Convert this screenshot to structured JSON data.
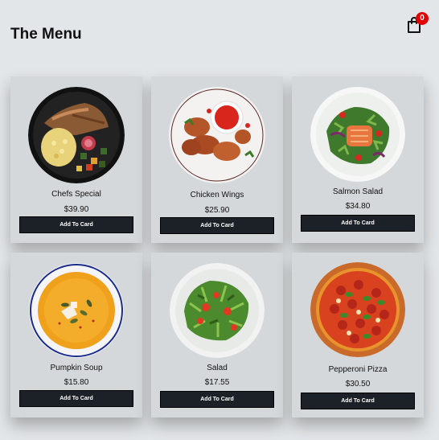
{
  "header": {
    "title": "The Menu",
    "cart_count": "0",
    "cart_icon": "shopping-bag-icon"
  },
  "colors": {
    "background": "#e3e6e8",
    "card": "#d5d8da",
    "button": "#1c2128",
    "badge": "#e50000"
  },
  "items": [
    {
      "name": "Chefs Special",
      "price": "$39.90",
      "button": "Add To Card"
    },
    {
      "name": "Chicken Wings",
      "price": "$25.90",
      "button": "Add To Card"
    },
    {
      "name": "Salmon Salad",
      "price": "$34.80",
      "button": "Add To Card"
    },
    {
      "name": "Pumpkin Soup",
      "price": "$15.80",
      "button": "Add To Card"
    },
    {
      "name": "Salad",
      "price": "$17.55",
      "button": "Add To Card"
    },
    {
      "name": "Pepperoni Pizza",
      "price": "$30.50",
      "button": "Add To Card"
    }
  ]
}
